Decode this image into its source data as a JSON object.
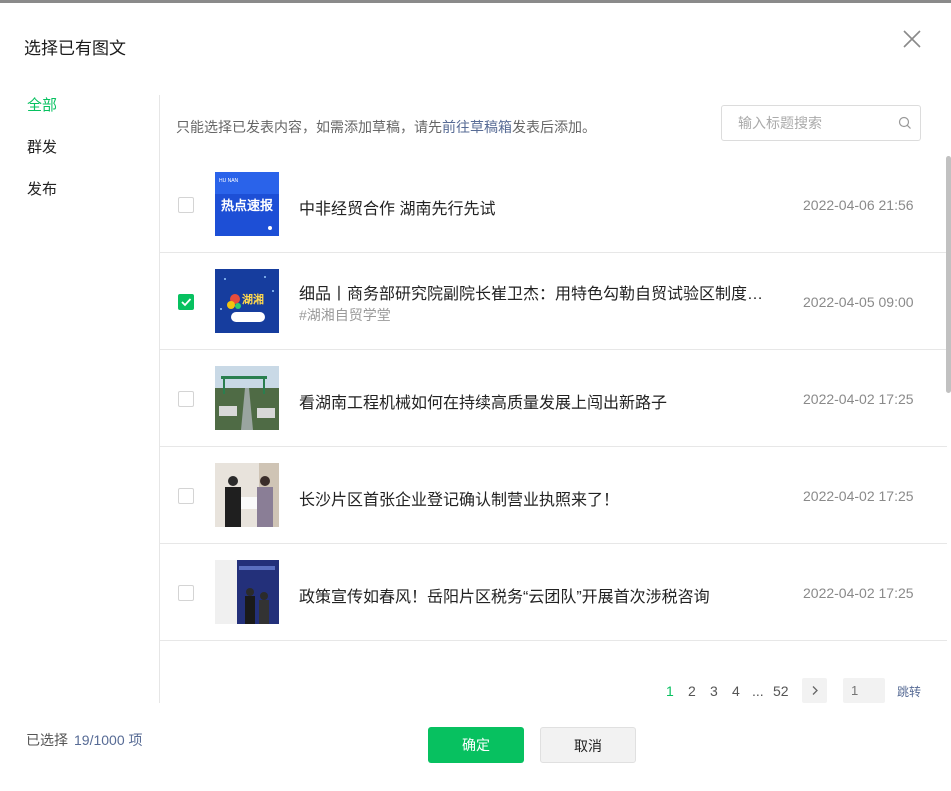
{
  "dialog": {
    "title": "选择已有图文"
  },
  "sidebar": {
    "items": [
      {
        "label": "全部",
        "active": true
      },
      {
        "label": "群发",
        "active": false
      },
      {
        "label": "发布",
        "active": false
      }
    ]
  },
  "notice": {
    "prefix": "只能选择已发表内容，如需添加草稿，请先",
    "link": "前往草稿箱",
    "suffix": "发表后添加。"
  },
  "search": {
    "placeholder": "输入标题搜索",
    "value": ""
  },
  "articles": [
    {
      "title": "中非经贸合作 湖南先行先试",
      "tag": "",
      "date": "2022-04-06 21:56",
      "checked": false,
      "thumb_text": "热点速报"
    },
    {
      "title": "细品丨商务部研究院副院长崔卫杰：用特色勾勒自贸试验区制度创新的“湖南样本”",
      "tag": "#湖湘自贸学堂",
      "date": "2022-04-05 09:00",
      "checked": true,
      "thumb_text": "湖湘"
    },
    {
      "title": "看湖南工程机械如何在持续高质量发展上闯出新路子",
      "tag": "",
      "date": "2022-04-02 17:25",
      "checked": false,
      "thumb_text": ""
    },
    {
      "title": "长沙片区首张企业登记确认制营业执照来了！",
      "tag": "",
      "date": "2022-04-02 17:25",
      "checked": false,
      "thumb_text": ""
    },
    {
      "title": "政策宣传如春风！岳阳片区税务“云团队”开展首次涉税咨询",
      "tag": "",
      "date": "2022-04-02 17:25",
      "checked": false,
      "thumb_text": ""
    }
  ],
  "pagination": {
    "pages": [
      "1",
      "2",
      "3",
      "4"
    ],
    "ellipsis": "...",
    "last": "52",
    "current": "1",
    "jump_placeholder": "1",
    "jump_label": "跳转"
  },
  "footer": {
    "selected_label": "已选择",
    "selected_count": "19/1000 项",
    "confirm": "确定",
    "cancel": "取消"
  },
  "colors": {
    "accent": "#07c160",
    "link": "#576b95"
  },
  "icons": {
    "close": "close-icon",
    "search": "search-icon",
    "next": "chevron-right-icon",
    "check": "check-icon"
  }
}
